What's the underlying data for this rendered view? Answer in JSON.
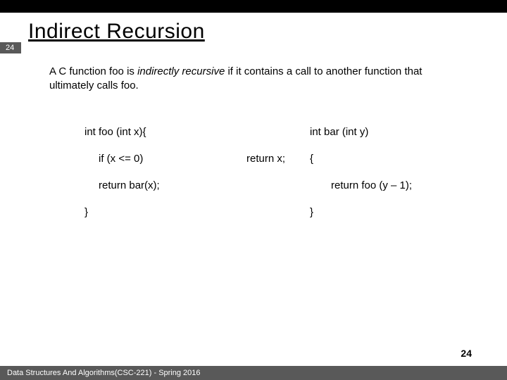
{
  "badge": "24",
  "title": "Indirect Recursion",
  "para_pre": "A C function foo is ",
  "para_em": "indirectly recursive",
  "para_post": " if it contains a call to another function that ultimately calls foo.",
  "code": {
    "r1c1": "int foo (int x){",
    "r1c3": "int bar (int y)",
    "r2c1": "if (x <= 0)",
    "r2c2": "return x;",
    "r2c3": "{",
    "r3c1": "return bar(x);",
    "r3c3": "return foo (y – 1);",
    "r4c1": "}",
    "r4c3": "}"
  },
  "page_num": "24",
  "footer": "Data Structures And Algorithms(CSC-221) - Spring 2016"
}
